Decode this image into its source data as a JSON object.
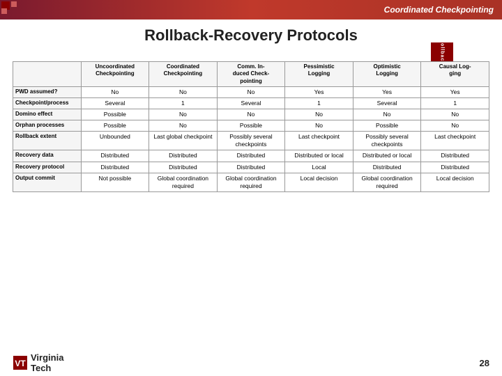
{
  "header": {
    "title": "Coordinated Checkpointing",
    "page_title": "Rollback-Recovery Protocols",
    "badge_text": "Rollback",
    "page_number": "28"
  },
  "table": {
    "columns": [
      "",
      "Uncoordinated Checkpointing",
      "Coordinated Checkpointing",
      "Comm. Induced Checkpointing",
      "Pessimistic Logging",
      "Optimistic Logging",
      "Causal Logging"
    ],
    "rows": [
      {
        "label": "PWD assumed?",
        "values": [
          "No",
          "No",
          "No",
          "Yes",
          "Yes",
          "Yes"
        ]
      },
      {
        "label": "Checkpoint/process",
        "values": [
          "Several",
          "1",
          "Several",
          "1",
          "Several",
          "1"
        ]
      },
      {
        "label": "Domino effect",
        "values": [
          "Possible",
          "No",
          "No",
          "No",
          "No",
          "No"
        ]
      },
      {
        "label": "Orphan processes",
        "values": [
          "Possible",
          "No",
          "Possible",
          "No",
          "Possible",
          "No"
        ]
      },
      {
        "label": "Rollback extent",
        "values": [
          "Unbounded",
          "Last global checkpoint",
          "Possibly several checkpoints",
          "Last checkpoint",
          "Possibly several checkpoints",
          "Last checkpoint"
        ]
      },
      {
        "label": "Recovery data",
        "values": [
          "Distributed",
          "Distributed",
          "Distributed",
          "Distributed or local",
          "Distributed or local",
          "Distributed"
        ]
      },
      {
        "label": "Recovery protocol",
        "values": [
          "Distributed",
          "Distributed",
          "Distributed",
          "Local",
          "Distributed",
          "Distributed"
        ]
      },
      {
        "label": "Output commit",
        "values": [
          "Not possible",
          "Global coordination required",
          "Global coordination required",
          "Local decision",
          "Global coordination required",
          "Local decision"
        ]
      }
    ]
  },
  "footer": {
    "logo_text": "Virginia",
    "logo_subtext": "Tech"
  }
}
